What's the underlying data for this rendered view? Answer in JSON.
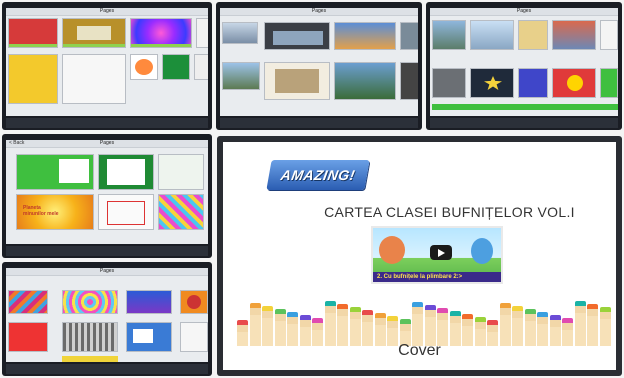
{
  "tiles": {
    "t1": {
      "title": "Pages"
    },
    "t2": {
      "title": "Pages"
    },
    "t3": {
      "title": "Pages"
    },
    "t4": {
      "title": "Pages",
      "back": "< Back",
      "thumb_text": "Planeta minunilor mele"
    },
    "t5": {
      "title": "Pages"
    }
  },
  "book": {
    "logo": "AMAZING!",
    "title": "CARTEA CLASEI BUFNIȚELOR VOL.I",
    "video_caption": "2. Cu bufnițele la plimbare 2:>",
    "cover_label": "Cover"
  },
  "icons": {
    "play": "play-icon"
  },
  "colors": {
    "bezel": "#1a1d24",
    "accent_green": "#3fbf3f",
    "accent_red": "#e53935",
    "logo_blue": "#2b5db2"
  }
}
